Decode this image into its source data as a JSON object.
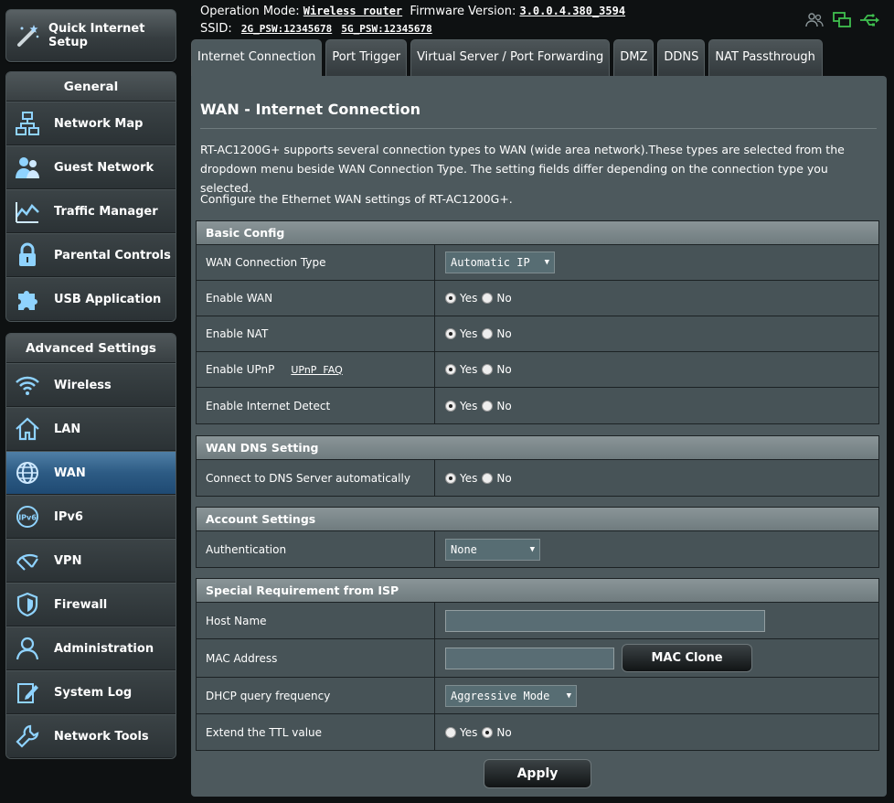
{
  "topbar": {
    "operation_mode_label": "Operation Mode:",
    "operation_mode_value": "Wireless router",
    "firmware_label": "Firmware Version:",
    "firmware_value": "3.0.0.4.380_3594",
    "ssid_label": "SSID:",
    "ssid_2g": "2G_PSW:12345678",
    "ssid_5g": "5G_PSW:12345678"
  },
  "sidebar": {
    "quick_setup_label": "Quick Internet Setup",
    "general_title": "General",
    "general_items": [
      {
        "label": "Network Map",
        "icon": "network-map-icon"
      },
      {
        "label": "Guest Network",
        "icon": "guest-network-icon"
      },
      {
        "label": "Traffic Manager",
        "icon": "traffic-manager-icon"
      },
      {
        "label": "Parental Controls",
        "icon": "lock-icon"
      },
      {
        "label": "USB Application",
        "icon": "puzzle-icon"
      }
    ],
    "advanced_title": "Advanced Settings",
    "advanced_items": [
      {
        "label": "Wireless",
        "icon": "wifi-icon"
      },
      {
        "label": "LAN",
        "icon": "home-icon"
      },
      {
        "label": "WAN",
        "icon": "globe-icon"
      },
      {
        "label": "IPv6",
        "icon": "ipv6-icon"
      },
      {
        "label": "VPN",
        "icon": "vpn-icon"
      },
      {
        "label": "Firewall",
        "icon": "shield-icon"
      },
      {
        "label": "Administration",
        "icon": "user-icon"
      },
      {
        "label": "System Log",
        "icon": "log-icon"
      },
      {
        "label": "Network Tools",
        "icon": "wrench-icon"
      }
    ],
    "active_item": "WAN"
  },
  "tabs": [
    {
      "label": "Internet Connection",
      "active": true
    },
    {
      "label": "Port Trigger",
      "active": false
    },
    {
      "label": "Virtual Server / Port Forwarding",
      "active": false
    },
    {
      "label": "DMZ",
      "active": false
    },
    {
      "label": "DDNS",
      "active": false
    },
    {
      "label": "NAT Passthrough",
      "active": false
    }
  ],
  "main": {
    "title": "WAN - Internet Connection",
    "description": "RT-AC1200G+ supports several connection types to WAN (wide area network).These types are selected from the dropdown menu beside WAN Connection Type. The setting fields differ depending on the connection type you selected.",
    "description2": "Configure the Ethernet WAN settings of RT-AC1200G+.",
    "yes": "Yes",
    "no": "No",
    "basic": {
      "title": "Basic Config",
      "wan_type_label": "WAN Connection Type",
      "wan_type_value": "Automatic IP",
      "enable_wan_label": "Enable WAN",
      "enable_nat_label": "Enable NAT",
      "enable_upnp_label": "Enable UPnP",
      "upnp_faq": "UPnP  FAQ",
      "internet_detect_label": "Enable Internet Detect"
    },
    "dns": {
      "title": "WAN DNS Setting",
      "auto_label": "Connect to DNS Server automatically"
    },
    "account": {
      "title": "Account Settings",
      "auth_label": "Authentication",
      "auth_value": "None"
    },
    "isp": {
      "title": "Special Requirement from ISP",
      "host_label": "Host Name",
      "host_value": "",
      "mac_label": "MAC Address",
      "mac_value": "",
      "mac_clone": "MAC Clone",
      "dhcp_label": "DHCP query frequency",
      "dhcp_value": "Aggressive Mode",
      "ttl_label": "Extend the TTL value"
    },
    "apply": "Apply"
  },
  "colors": {
    "panel": "#4d595d",
    "active_nav": "#2d5b84",
    "status_green": "#3fbf4f"
  }
}
